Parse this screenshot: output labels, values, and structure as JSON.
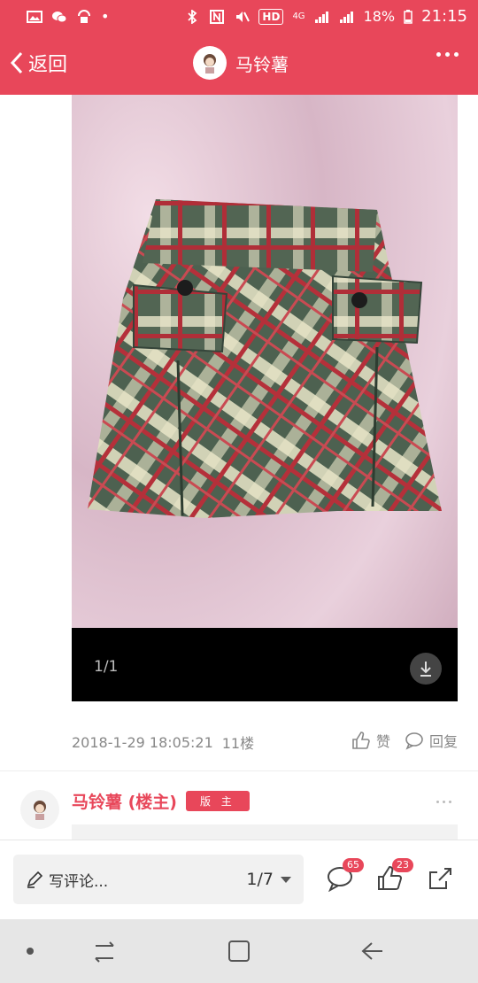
{
  "status_bar": {
    "battery": "18%",
    "time": "21:15",
    "network": "4G",
    "hd": "HD"
  },
  "nav": {
    "back_label": "返回",
    "title": "马铃薯",
    "more_icon": "more-horizontal-icon"
  },
  "post_image": {
    "counter": "1/1",
    "download_icon": "download-icon"
  },
  "post_meta": {
    "timestamp": "2018-1-29 18:05:21",
    "floor": "11楼",
    "like_label": "赞",
    "reply_label": "回复"
  },
  "next_post": {
    "author": "马铃薯 (楼主)",
    "badge": "版 主"
  },
  "bottom_bar": {
    "comment_placeholder": "写评论...",
    "page_indicator": "1/7",
    "comment_count": "65",
    "like_count": "23"
  },
  "colors": {
    "brand": "#e8475a",
    "meta_gray": "#888888"
  }
}
